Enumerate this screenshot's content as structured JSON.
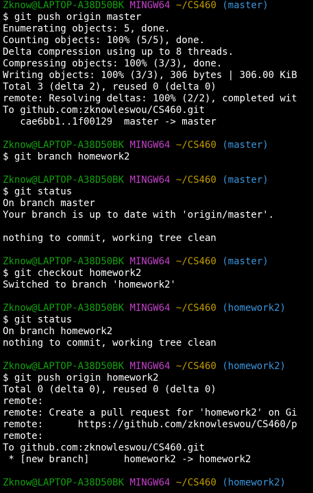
{
  "colors": {
    "background": "#000000",
    "text": "#ffffff",
    "user_host": "#13a10e",
    "mingw": "#c341c9",
    "path": "#c19c00",
    "branch": "#3a96dd"
  },
  "blocks": [
    {
      "prompt": {
        "user_host": "Zknow@LAPTOP-A38D50BK",
        "env": "MINGW64",
        "path": "~/CS460",
        "branch": "(master)"
      },
      "command": "$ git push origin master",
      "output": [
        "Enumerating objects: 5, done.",
        "Counting objects: 100% (5/5), done.",
        "Delta compression using up to 8 threads.",
        "Compressing objects: 100% (3/3), done.",
        "Writing objects: 100% (3/3), 306 bytes | 306.00 KiB",
        "Total 3 (delta 2), reused 0 (delta 0)",
        "remote: Resolving deltas: 100% (2/2), completed wit",
        "To github.com:zknowleswou/CS460.git",
        "   cae6bb1..1f00129  master -> master"
      ]
    },
    {
      "prompt": {
        "user_host": "Zknow@LAPTOP-A38D50BK",
        "env": "MINGW64",
        "path": "~/CS460",
        "branch": "(master)"
      },
      "command": "$ git branch homework2",
      "output": []
    },
    {
      "prompt": {
        "user_host": "Zknow@LAPTOP-A38D50BK",
        "env": "MINGW64",
        "path": "~/CS460",
        "branch": "(master)"
      },
      "command": "$ git status",
      "output": [
        "On branch master",
        "Your branch is up to date with 'origin/master'.",
        "",
        "nothing to commit, working tree clean"
      ]
    },
    {
      "prompt": {
        "user_host": "Zknow@LAPTOP-A38D50BK",
        "env": "MINGW64",
        "path": "~/CS460",
        "branch": "(master)"
      },
      "command": "$ git checkout homework2",
      "output": [
        "Switched to branch 'homework2'"
      ]
    },
    {
      "prompt": {
        "user_host": "Zknow@LAPTOP-A38D50BK",
        "env": "MINGW64",
        "path": "~/CS460",
        "branch": "(homework2)"
      },
      "command": "$ git status",
      "output": [
        "On branch homework2",
        "nothing to commit, working tree clean"
      ]
    },
    {
      "prompt": {
        "user_host": "Zknow@LAPTOP-A38D50BK",
        "env": "MINGW64",
        "path": "~/CS460",
        "branch": "(homework2)"
      },
      "command": "$ git push origin homework2",
      "output": [
        "Total 0 (delta 0), reused 0 (delta 0)",
        "remote:",
        "remote: Create a pull request for 'homework2' on Gi",
        "remote:      https://github.com/zknowleswou/CS460/p",
        "remote:",
        "To github.com:zknowleswou/CS460.git",
        " * [new branch]      homework2 -> homework2"
      ]
    },
    {
      "prompt": {
        "user_host": "Zknow@LAPTOP-A38D50BK",
        "env": "MINGW64",
        "path": "~/CS460",
        "branch": "(homework2)"
      },
      "command": null,
      "output": []
    }
  ]
}
